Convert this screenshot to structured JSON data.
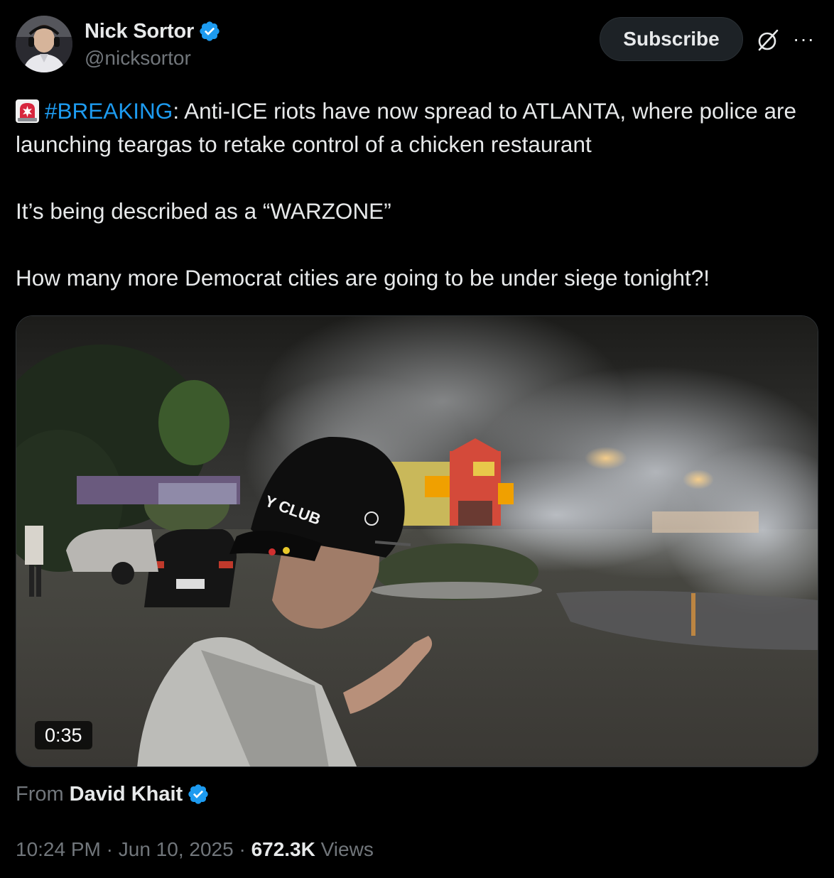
{
  "author": {
    "display_name": "Nick Sortor",
    "handle": "@nicksortor",
    "verified": true
  },
  "actions": {
    "subscribe_label": "Subscribe",
    "grok_icon": "grok-icon",
    "more_label": "···"
  },
  "tweet": {
    "siren_icon": "police-siren-emoji",
    "hashtag": "#BREAKING",
    "line1_rest": ": Anti-ICE riots have now spread to ATLANTA, where police are launching teargas to retake control of a chicken restaurant",
    "paragraph2": "It’s being described as a “WARZONE”",
    "paragraph3": "How many more Democrat cities are going to be under siege tonight?!"
  },
  "media": {
    "duration": "0:35"
  },
  "attribution": {
    "from_label": "From",
    "from_name": "David Khait",
    "verified": true
  },
  "meta": {
    "time": "10:24 PM",
    "separator1": " · ",
    "date": "Jun 10, 2025",
    "separator2": " · ",
    "views_count": "672.3K",
    "views_label": " Views"
  },
  "colors": {
    "background": "#000000",
    "text": "#e7e9ea",
    "secondary_text": "#71767b",
    "link": "#1d9bf0",
    "verified_badge": "#1d9bf0"
  }
}
